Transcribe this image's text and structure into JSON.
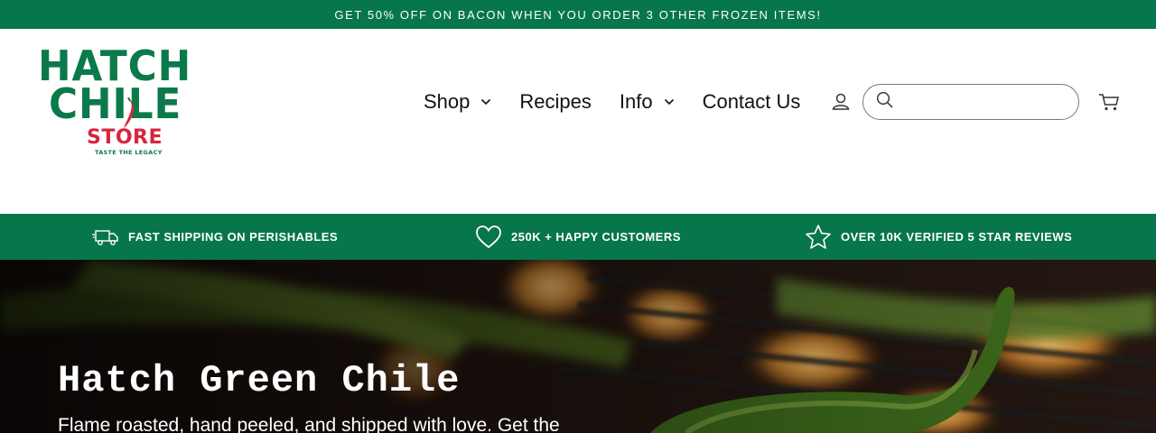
{
  "announcement": {
    "text": "GET 50% OFF ON BACON WHEN YOU ORDER 3 OTHER FROZEN ITEMS!"
  },
  "logo": {
    "line1": "HATCH",
    "line2": "CHILE",
    "line3": "STORE",
    "tagline": "TASTE THE LEGACY"
  },
  "nav": {
    "items": [
      {
        "label": "Shop",
        "has_dropdown": true
      },
      {
        "label": "Recipes",
        "has_dropdown": false
      },
      {
        "label": "Info",
        "has_dropdown": true
      },
      {
        "label": "Contact Us",
        "has_dropdown": false
      }
    ]
  },
  "header_icons": {
    "account": "account-icon",
    "search": "search-icon",
    "cart": "cart-icon"
  },
  "search": {
    "value": "",
    "placeholder": ""
  },
  "trust_bar": {
    "items": [
      {
        "icon": "truck-icon",
        "label": "FAST SHIPPING ON PERISHABLES"
      },
      {
        "icon": "heart-icon",
        "label": "250K + HAPPY CUSTOMERS"
      },
      {
        "icon": "star-icon",
        "label": "OVER 10K VERIFIED 5 STAR REVIEWS"
      }
    ]
  },
  "hero": {
    "title": "Hatch Green Chile",
    "subtitle": "Flame roasted, hand peeled, and shipped with love. Get the"
  },
  "colors": {
    "brand_green": "#07764b",
    "logo_red": "#d7263d"
  }
}
